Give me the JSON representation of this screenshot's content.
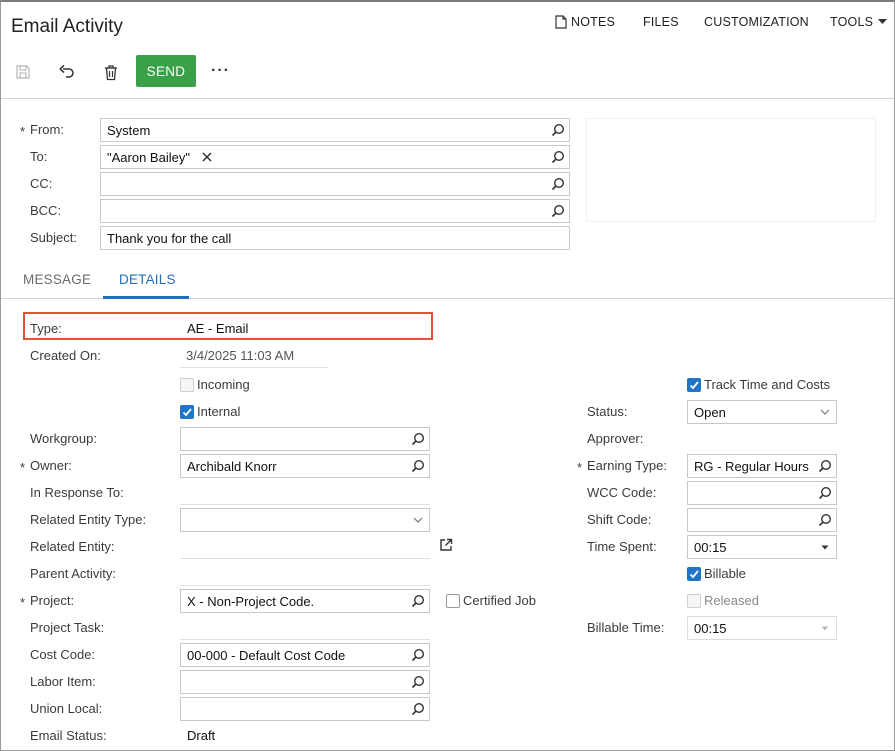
{
  "header": {
    "title": "Email Activity",
    "links": {
      "notes": "NOTES",
      "files": "FILES",
      "customization": "CUSTOMIZATION",
      "tools": "TOOLS"
    }
  },
  "toolbar": {
    "send_label": "SEND",
    "more_label": "···"
  },
  "email": {
    "from_label": "From:",
    "from_value": "System",
    "to_label": "To:",
    "to_value": "\"Aaron Bailey\"",
    "cc_label": "CC:",
    "cc_value": "",
    "bcc_label": "BCC:",
    "bcc_value": "",
    "subject_label": "Subject:",
    "subject_value": "Thank you for the call"
  },
  "tabs": {
    "message": "MESSAGE",
    "details": "DETAILS"
  },
  "details": {
    "type_label": "Type:",
    "type_value": "AE - Email",
    "created_on_label": "Created On:",
    "created_on_value": "3/4/2025 11:03 AM",
    "incoming_label": "Incoming",
    "internal_label": "Internal",
    "workgroup_label": "Workgroup:",
    "workgroup_value": "",
    "owner_label": "Owner:",
    "owner_value": "Archibald Knorr",
    "in_response_label": "In Response To:",
    "related_entity_type_label": "Related Entity Type:",
    "related_entity_type_value": "",
    "related_entity_label": "Related Entity:",
    "parent_activity_label": "Parent Activity:",
    "project_label": "Project:",
    "project_value": "X - Non-Project Code.",
    "certified_job_label": "Certified Job",
    "project_task_label": "Project Task:",
    "cost_code_label": "Cost Code:",
    "cost_code_value": "00-000 - Default Cost Code",
    "labor_item_label": "Labor Item:",
    "labor_item_value": "",
    "union_local_label": "Union Local:",
    "union_local_value": "",
    "email_status_label": "Email Status:",
    "email_status_value": "Draft",
    "track_time_label": "Track Time and Costs",
    "status_label": "Status:",
    "status_value": "Open",
    "approver_label": "Approver:",
    "earning_type_label": "Earning Type:",
    "earning_type_value": "RG - Regular Hours",
    "wcc_code_label": "WCC Code:",
    "wcc_code_value": "",
    "shift_code_label": "Shift Code:",
    "shift_code_value": "",
    "time_spent_label": "Time Spent:",
    "time_spent_value": "00:15",
    "billable_label": "Billable",
    "released_label": "Released",
    "billable_time_label": "Billable Time:",
    "billable_time_value": "00:15",
    "required_mark": "*"
  },
  "colors": {
    "accent": "#1e6fbf",
    "send": "#3aa148",
    "highlight": "#e0533a"
  }
}
